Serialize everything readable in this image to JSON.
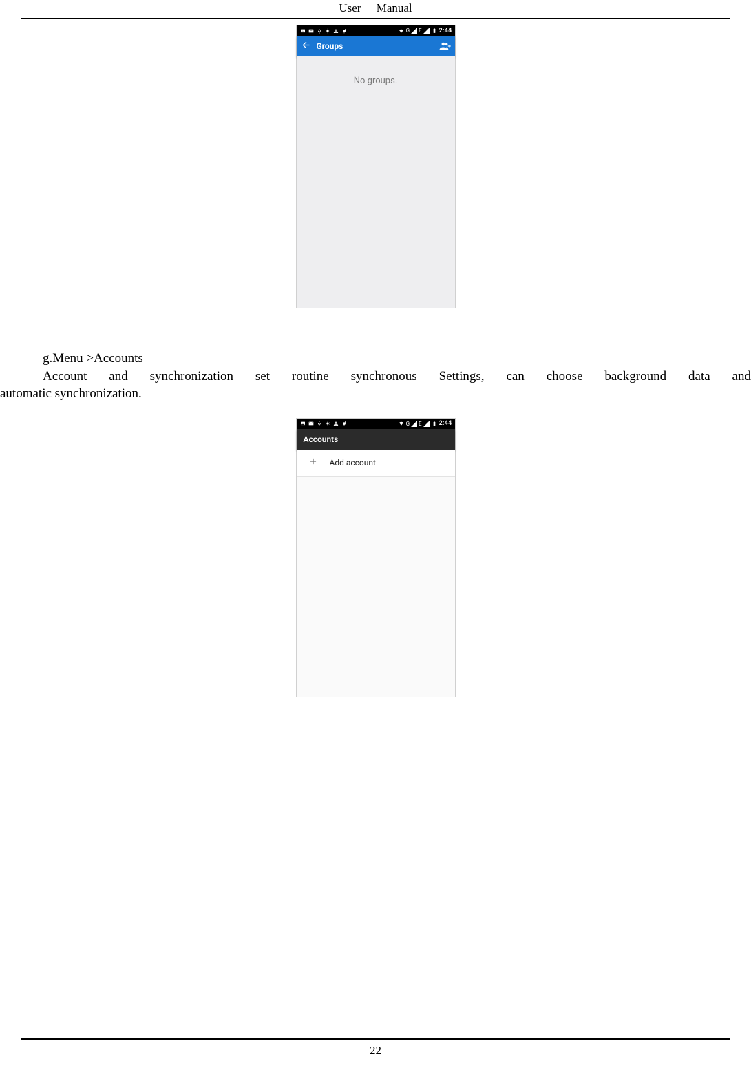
{
  "doc": {
    "header_a": "User",
    "header_b": "Manual",
    "page_number": "22",
    "section_heading": "g.Menu >Accounts",
    "paragraph_line1": "Account and synchronization set routine synchronous Settings, can choose background data and",
    "paragraph_line2": "automatic synchronization."
  },
  "status": {
    "time": "2:44",
    "network_label": "G",
    "network_label2": "E"
  },
  "groups_screen": {
    "title": "Groups",
    "empty_message": "No groups."
  },
  "accounts_screen": {
    "title": "Accounts",
    "items": [
      {
        "label": "Add account"
      }
    ]
  },
  "colors": {
    "blue": "#1a77d4",
    "dark": "#2b2b2b"
  }
}
